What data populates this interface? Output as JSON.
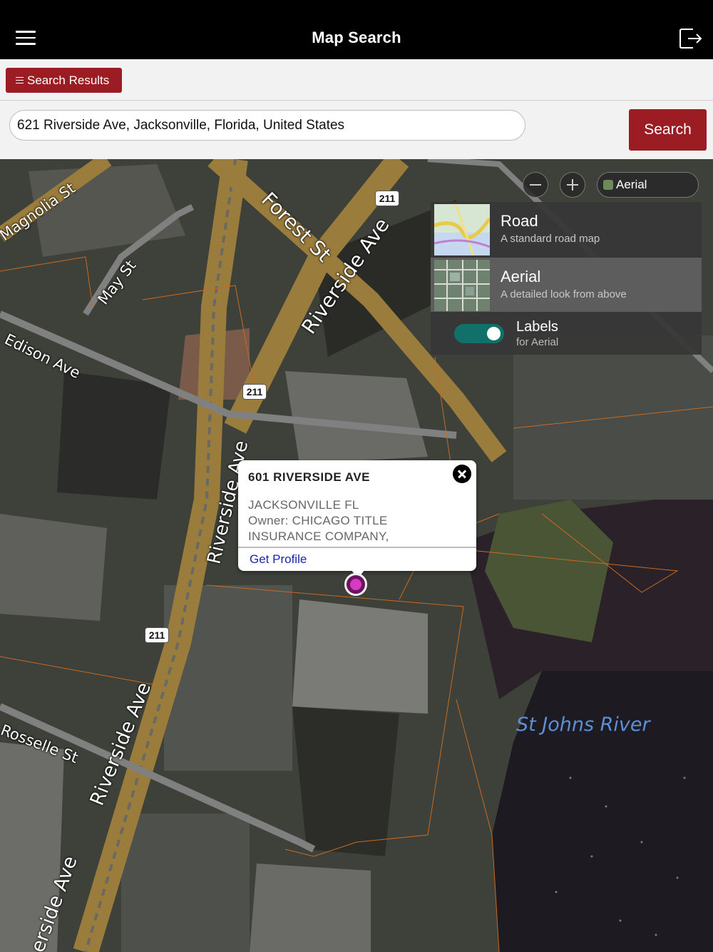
{
  "header": {
    "title": "Map Search"
  },
  "results_button": {
    "label": "Search Results"
  },
  "search": {
    "value": "621 Riverside Ave, Jacksonville, Florida, United States",
    "button_label": "Search"
  },
  "map": {
    "layer_pill": "Aerial",
    "layers": [
      {
        "name": "Road",
        "description": "A standard road map",
        "selected": false
      },
      {
        "name": "Aerial",
        "description": "A detailed look from above",
        "selected": true
      }
    ],
    "labels_toggle": {
      "title": "Labels",
      "subtitle": "for Aerial",
      "on": true
    },
    "streets": {
      "magnolia": "Magnolia St",
      "forest": "Forest St",
      "riverside_top": "Riverside Ave",
      "may": "May St",
      "edison": "Edison Ave",
      "riverside_mid": "Riverside Ave",
      "riverside_lower": "Riverside Ave",
      "rosselle": "Rosselle St",
      "riverside_bottom": "erside Ave",
      "river": "St Johns River"
    },
    "route_badges": [
      "211",
      "211",
      "211"
    ],
    "popup": {
      "title": "601 RIVERSIDE AVE",
      "city": "JACKSONVILLE FL",
      "owner": "Owner: CHICAGO TITLE",
      "owner_cont": "INSURANCE COMPANY,",
      "link": "Get Profile"
    }
  },
  "colors": {
    "accent": "#9b1c22",
    "toggle": "#12706a",
    "pin": "#d63bc4",
    "road": "#9a7c3c"
  }
}
